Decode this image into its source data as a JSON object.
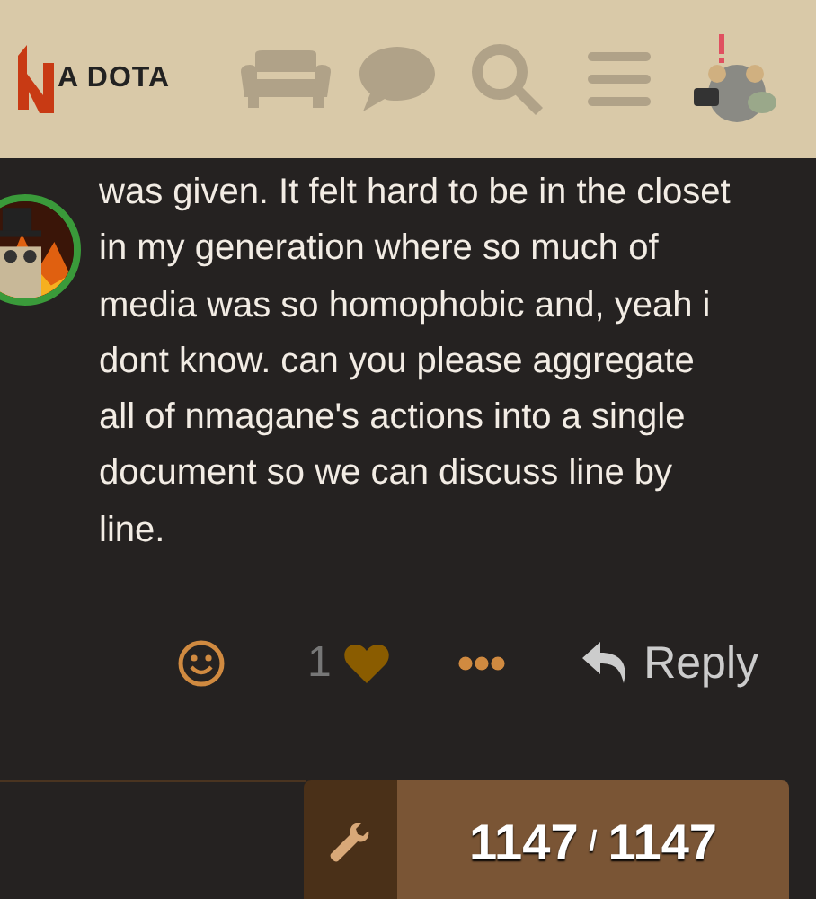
{
  "header": {
    "logo_text": "A DOTA"
  },
  "post": {
    "text": "was given. It felt hard to be in the closet in my generation where so much of media was so homophobic and, yeah i dont know. can you please aggregate all of nmagane's actions into a single document so we can discuss line by line.",
    "author_online": true
  },
  "actions": {
    "like_count": "1",
    "liked": true,
    "reply_label": "Reply"
  },
  "progress": {
    "current": "1147",
    "separator": "/",
    "total": "1147"
  }
}
